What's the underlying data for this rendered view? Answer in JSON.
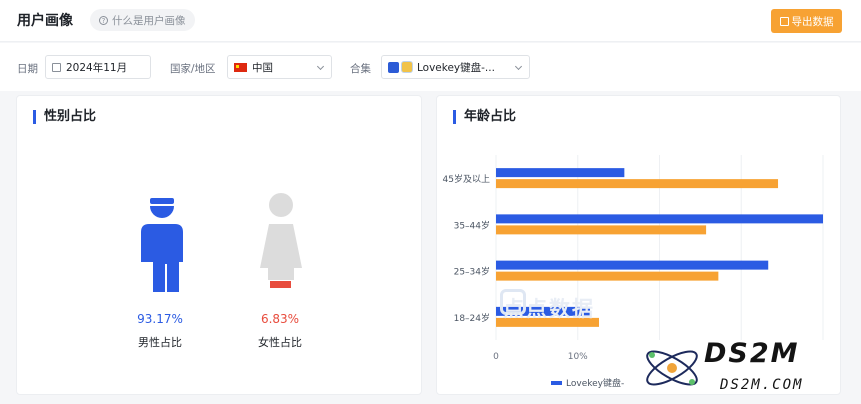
{
  "header": {
    "title": "用户画像",
    "help_label": "什么是用户画像",
    "export_label": "导出数据"
  },
  "filters": {
    "date_label": "日期",
    "date_value": "2024年11月",
    "country_label": "国家/地区",
    "country_value": "中国",
    "collection_label": "合集",
    "collection_value": "Lovekey键盘-..."
  },
  "gender": {
    "title": "性别占比",
    "male": {
      "percent": "93.17%",
      "label": "男性占比",
      "value": 93.17,
      "color": "#2b5be3"
    },
    "female": {
      "percent": "6.83%",
      "label": "女性占比",
      "value": 6.83,
      "color": "#e84c3d"
    }
  },
  "age": {
    "title": "年龄占比"
  },
  "chart_data": {
    "type": "bar",
    "orientation": "horizontal",
    "categories": [
      "45岁及以上",
      "35–44岁",
      "25–34岁",
      "18–24岁"
    ],
    "series": [
      {
        "name": "Lovekey键盘-",
        "color": "#2b5be3",
        "values": [
          15.7,
          40,
          33.3,
          11.5
        ]
      },
      {
        "color": "#f7a233",
        "values": [
          34.5,
          25.7,
          27.2,
          12.6
        ]
      }
    ],
    "x_ticks": [
      "0",
      "10%"
    ],
    "xlim": [
      0,
      40
    ],
    "grid": true,
    "legend_position": "bottom"
  },
  "watermark": {
    "text": "点点数据"
  },
  "logo": {
    "big": "DS2M",
    "small": "DS2M.COM"
  }
}
